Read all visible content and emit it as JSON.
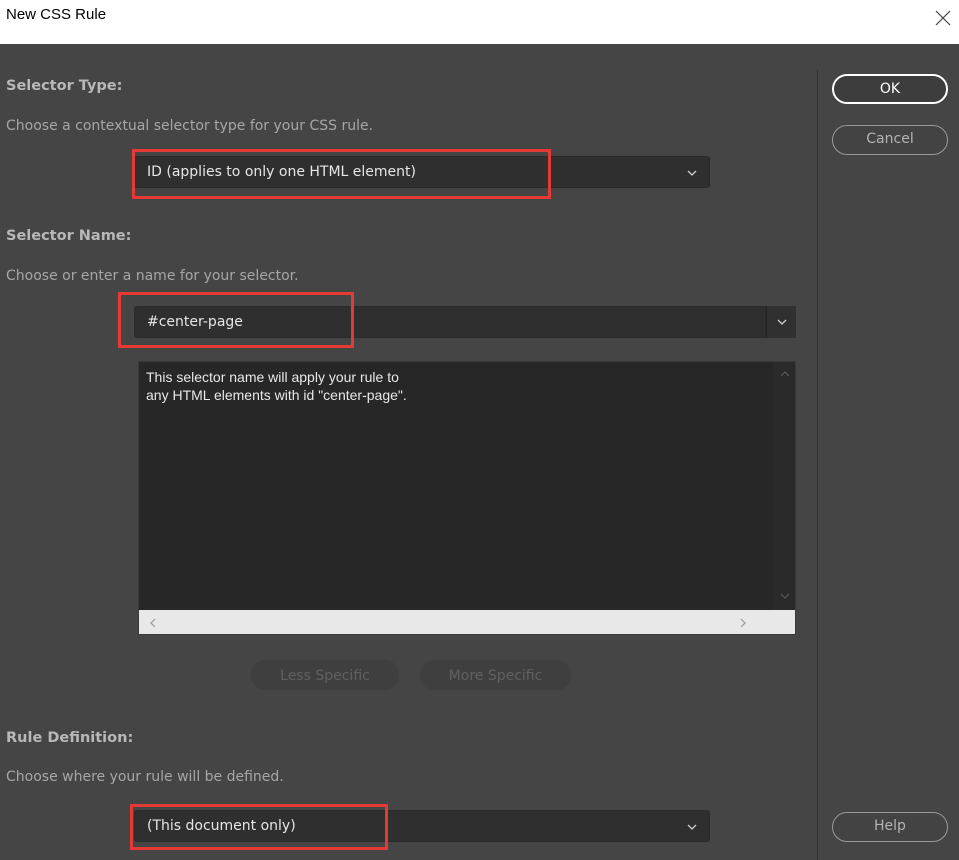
{
  "window": {
    "title": "New CSS Rule",
    "close_icon": "close-icon"
  },
  "selector_type": {
    "heading": "Selector Type:",
    "hint": "Choose a contextual selector type for your CSS rule.",
    "selected": "ID (applies to only one HTML element)"
  },
  "selector_name": {
    "heading": "Selector Name:",
    "hint": "Choose or enter a name for your selector.",
    "value": "#center-page",
    "description_line1": "This selector name will apply your rule to",
    "description_line2": "any HTML elements with id \"center-page\".",
    "less_specific": "Less Specific",
    "more_specific": "More Specific"
  },
  "rule_definition": {
    "heading": "Rule Definition:",
    "hint": "Choose where your rule will be defined.",
    "selected": "(This document only)"
  },
  "buttons": {
    "ok": "OK",
    "cancel": "Cancel",
    "help": "Help"
  },
  "colors": {
    "dialog_bg": "#454545",
    "field_bg": "#2f2f2f",
    "highlight": "#e53935"
  }
}
